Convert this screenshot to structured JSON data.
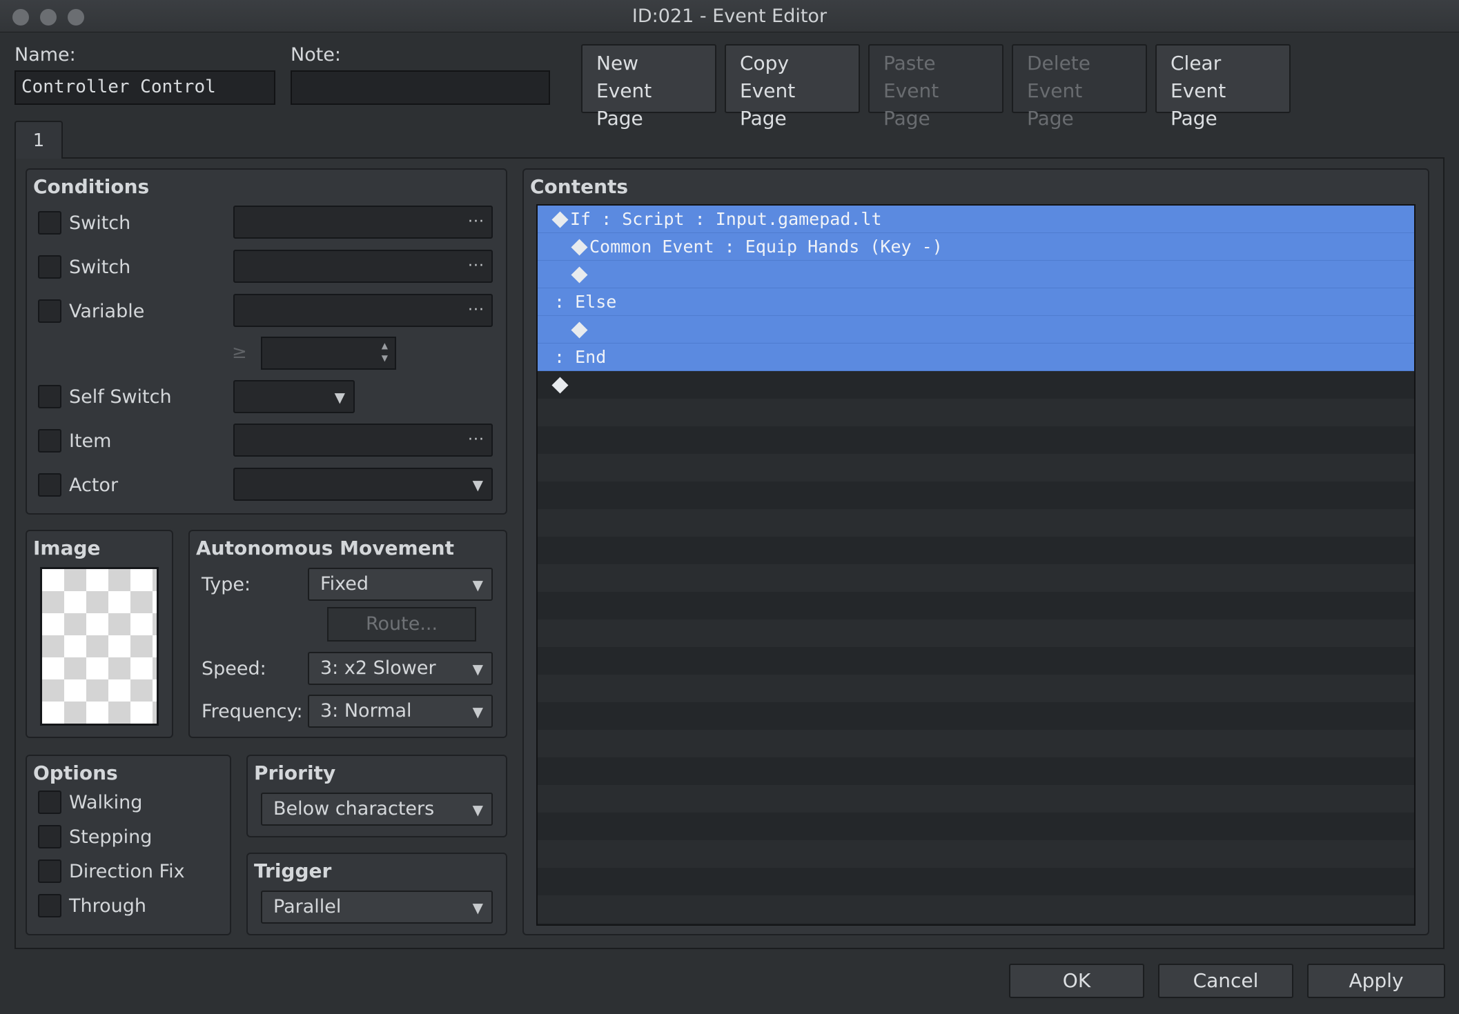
{
  "window": {
    "title": "ID:021 - Event Editor"
  },
  "name_field": {
    "label": "Name:",
    "value": "Controller Control"
  },
  "note_field": {
    "label": "Note:",
    "value": ""
  },
  "page_buttons": {
    "new": [
      "New",
      "Event Page"
    ],
    "copy": [
      "Copy",
      "Event Page"
    ],
    "paste": [
      "Paste",
      "Event Page"
    ],
    "delete": [
      "Delete",
      "Event Page"
    ],
    "clear": [
      "Clear",
      "Event Page"
    ]
  },
  "tabs": [
    {
      "label": "1"
    }
  ],
  "conditions": {
    "header": "Conditions",
    "switch1": "Switch",
    "switch2": "Switch",
    "variable": "Variable",
    "gte": "≥",
    "self_switch": "Self Switch",
    "item": "Item",
    "actor": "Actor",
    "ellipsis": "···",
    "arrow": "▼"
  },
  "image": {
    "header": "Image"
  },
  "movement": {
    "header": "Autonomous Movement",
    "type_label": "Type:",
    "type_value": "Fixed",
    "route_button": "Route...",
    "speed_label": "Speed:",
    "speed_value": "3: x2 Slower",
    "frequency_label": "Frequency:",
    "frequency_value": "3: Normal"
  },
  "options": {
    "header": "Options",
    "walking": "Walking",
    "stepping": "Stepping",
    "direction_fix": "Direction Fix",
    "through": "Through"
  },
  "priority": {
    "header": "Priority",
    "value": "Below characters"
  },
  "trigger": {
    "header": "Trigger",
    "value": "Parallel"
  },
  "contents": {
    "header": "Contents",
    "lines": [
      {
        "text": "If : Script : Input.gamepad.lt",
        "diamond": true,
        "indent": 0,
        "selected": true
      },
      {
        "text": "Common Event : Equip Hands (Key -)",
        "diamond": true,
        "indent": 1,
        "selected": true
      },
      {
        "text": "",
        "diamond": true,
        "indent": 1,
        "selected": true
      },
      {
        "text": ": Else",
        "diamond": false,
        "indent": 0,
        "selected": true
      },
      {
        "text": "",
        "diamond": true,
        "indent": 1,
        "selected": true
      },
      {
        "text": ": End",
        "diamond": false,
        "indent": 0,
        "selected": true
      },
      {
        "text": "",
        "diamond": true,
        "indent": 0,
        "selected": false
      }
    ]
  },
  "footer": {
    "ok": "OK",
    "cancel": "Cancel",
    "apply": "Apply"
  }
}
